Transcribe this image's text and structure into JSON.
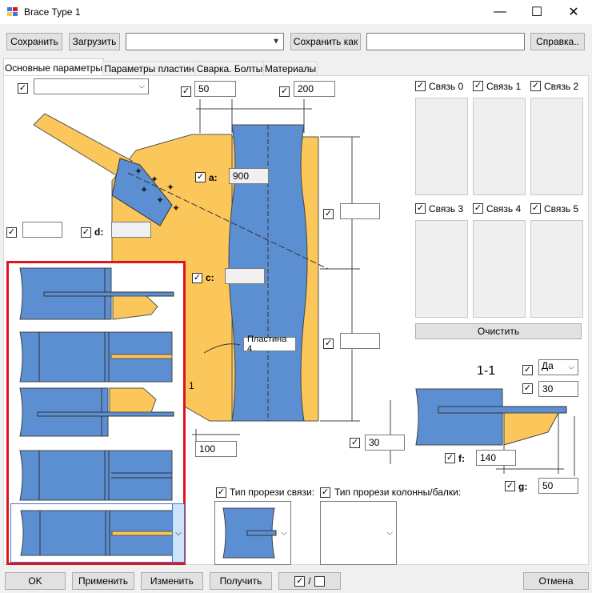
{
  "window": {
    "title": "Brace Type 1",
    "minimize": "—",
    "maximize": "☐",
    "close": "✕"
  },
  "toolbar": {
    "save": "Сохранить",
    "load": "Загрузить",
    "preset_value": "",
    "save_as": "Сохранить как",
    "save_as_value": "",
    "help": "Справка.."
  },
  "tabs": [
    "Основные параметры",
    "Параметры пластин",
    "Сварка. Болты",
    "Материалы"
  ],
  "params": {
    "top_combo": "",
    "w1": "50",
    "w2": "200",
    "a_label": "a:",
    "a_value": "900",
    "d_label": "d:",
    "d_value": "",
    "c_label": "c:",
    "c_value": "",
    "left_value": "",
    "right_top_value": "",
    "right_mid_value": "",
    "bottom_value": "100",
    "plate_label": "Пластина 4",
    "section_label": "1-1",
    "yes_value": "Да",
    "v30a": "30",
    "v30b": "30",
    "f_label": "f:",
    "f_value": "140",
    "g_label": "g:",
    "g_value": "50"
  },
  "links": [
    "Связь 0",
    "Связь 1",
    "Связь 2",
    "Связь 3",
    "Связь 4",
    "Связь 5"
  ],
  "clear_button": "Очистить",
  "slot_type": {
    "brace_label": "Тип прорези связи:",
    "column_label": "Тип прорези колонны/балки:"
  },
  "footer": {
    "ok": "OK",
    "apply": "Применить",
    "change": "Изменить",
    "get": "Получить",
    "toggle": "/",
    "cancel": "Отмена"
  },
  "colors": {
    "steel": "#5b8fd1",
    "plate": "#fbc75b",
    "highlight": "#e0141e"
  }
}
